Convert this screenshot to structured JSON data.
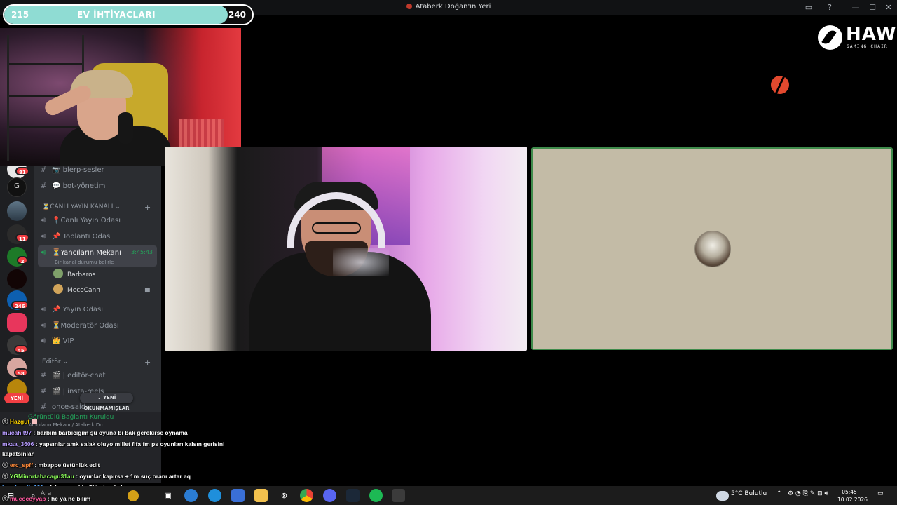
{
  "window": {
    "title": "Ataberk Doğan'ın Yeri",
    "controls": [
      "▭",
      "?",
      "—",
      "☐",
      "✕"
    ]
  },
  "goal": {
    "label": "EV İHTİYACLARI",
    "start": "215",
    "end": "240",
    "progress": 0.9,
    "fill_color": "#8fdcd3"
  },
  "webcam_server_label": "Ataberk Doğan'ın Yeri",
  "sidebar": {
    "guild_badges": [
      {
        "count": "81",
        "color": "#f23f43"
      },
      {
        "count": "11",
        "color": "#f23f43"
      },
      {
        "count": "2",
        "color": "#f23f43"
      },
      {
        "count": "246",
        "color": "#f23f43"
      },
      {
        "count": "45",
        "color": "#f23f43"
      },
      {
        "count": "58",
        "color": "#f23f43"
      }
    ],
    "new_label": "YENİ",
    "channels": [
      {
        "name": "📷 blerp-sesler",
        "type": "text"
      },
      {
        "name": "💬 bot-yönetim",
        "type": "text"
      }
    ],
    "category_live": "⏳CANLI YAYIN KANALI",
    "voice_channels": [
      {
        "name": "📍Canlı Yayın Odası"
      },
      {
        "name": "📌 Toplantı Odası"
      },
      {
        "name": "⏳Yancıların Mekanı",
        "time": "3:45:43",
        "status": "Bir kanal durumu belirle"
      }
    ],
    "members": [
      {
        "name": "Barbaros",
        "color": "#7fa06a"
      },
      {
        "name": "MecoCann",
        "color": "#d1a45a"
      }
    ],
    "more_voice": [
      {
        "name": "📌 Yayın Odası"
      },
      {
        "name": "⏳Moderatör Odası"
      },
      {
        "name": "👑 VIP"
      }
    ],
    "category_editor": "Editör",
    "editor_channels": [
      {
        "name": "🎬 | editör-chat"
      },
      {
        "name": "🎬 | insta-reels"
      },
      {
        "name": "once-said"
      }
    ],
    "unread_label": "YENİ OKUNMAMIŞLAR"
  },
  "voice_status": {
    "connected": "Görüntülü Bağlantı Kuruldu",
    "location": "Yancıların Mekanı / Ataberk Do..."
  },
  "sponsor": {
    "name": "HAWK",
    "tagline": "GAMING CHAIR"
  },
  "chat": [
    {
      "user": "Hazgut",
      "user_color": "#ffd400",
      "text": ""
    },
    {
      "user": "mucahit97",
      "user_color": "#b79cff",
      "text": "barbim barbicigim şu oyuna bi bak gerekirse oynama"
    },
    {
      "user": "mkaa_3606",
      "user_color": "#b79cff",
      "text": "yapsınlar amk salak oluyo millet fifa fm ps oyunları kalsın gerisini"
    },
    {
      "user": "",
      "user_color": "#ffffff",
      "text": "kapatsınlar"
    },
    {
      "user": "erc_spff",
      "user_color": "#ff8a3a",
      "text": "mbappe üstünlük edit"
    },
    {
      "user": "YGMinortabacagu31au",
      "user_color": "#8dff5a",
      "text": "oyunlar kapırsa + 1m suç oranı artar aq"
    },
    {
      "user": "buraksmile121",
      "user_color": "#5aa9ff",
      "text": "Adaşım sakin Silivri soğuktur"
    },
    {
      "user": "mucoceyyap",
      "user_color": "#ff5aa0",
      "text": "he ya ne bilim"
    }
  ],
  "taskbar": {
    "weather": "5°C  Bulutlu",
    "time": "05:45",
    "date": "10.02.2026",
    "search_placeholder": "Ara"
  }
}
